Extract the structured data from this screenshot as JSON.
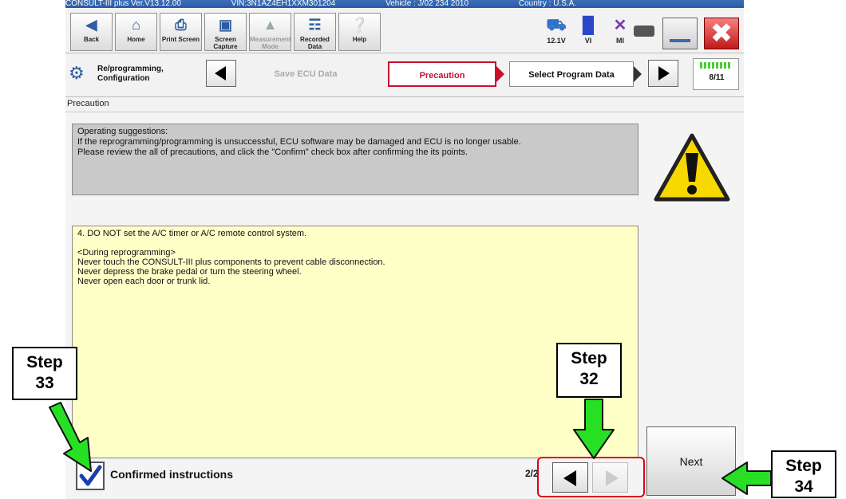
{
  "title_bar": {
    "app": "CONSULT-III plus  Ver.V13.12.00",
    "vin": "VIN:3N1AZ4EH1XXM301204",
    "vehicle": "Vehicle : J/02 234 2010",
    "country": "Country : U.S.A."
  },
  "toolbar": {
    "back": "Back",
    "home": "Home",
    "print_screen": "Print Screen",
    "screen_capture": "Screen Capture",
    "measurement_mode": "Measurement Mode",
    "recorded_data": "Recorded Data",
    "help": "Help",
    "battery_voltage": "12.1V",
    "vi_label": "VI",
    "mi_label": "MI"
  },
  "breadcrumb": {
    "section": "Re/programming, Configuration",
    "prev_step": "Save ECU Data",
    "current_step": "Precaution",
    "next_step": "Select Program Data",
    "progress": "8/11"
  },
  "section_label": "Precaution",
  "operating_suggestions": {
    "heading": "Operating  suggestions:",
    "line1": "If the reprogramming/programming is unsuccessful, ECU software may be damaged and ECU is no longer usable.",
    "line2": "Please review the all of precautions, and click the \"Confirm\" check box after confirming the its points."
  },
  "precaution_text": {
    "item4": "4. DO NOT set the A/C timer or A/C remote control system.",
    "during_heading": "<During  reprogramming>",
    "never1": "Never touch the CONSULT-III plus components to prevent cable disconnection.",
    "never2": "Never depress the brake pedal or turn the steering wheel.",
    "never3": "Never open each door or trunk lid."
  },
  "footer": {
    "confirm_label": "Confirmed instructions",
    "page_indicator": "2/2",
    "next_button": "Next",
    "confirmed": true
  },
  "callouts": {
    "step33": [
      "Step",
      "33"
    ],
    "step32": [
      "Step",
      "32"
    ],
    "step34": [
      "Step",
      "34"
    ]
  },
  "colors": {
    "arrow_green": "#27e024",
    "highlight_red": "#e2001a",
    "text_pane_yellow": "#ffffc8",
    "active_crumb_red": "#c8102e",
    "title_bar_blue": "#2a5aa3"
  }
}
